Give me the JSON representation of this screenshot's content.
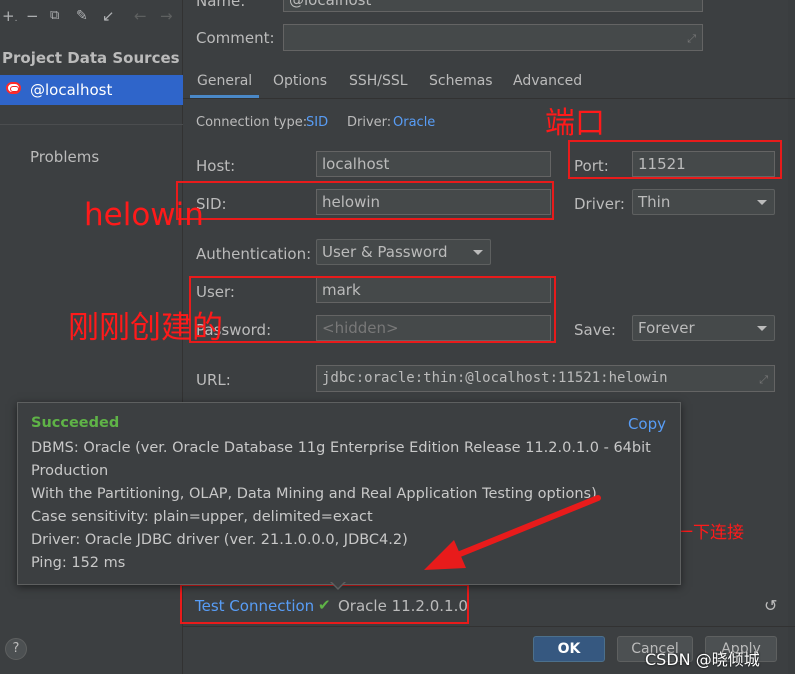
{
  "sidebar": {
    "toolbar_icons": [
      "+.",
      "−",
      "⧉",
      "🔧",
      "↙",
      "←",
      "→"
    ],
    "title": "Project Data Sources",
    "selected_item": "@localhost",
    "problems": "Problems",
    "help": "?"
  },
  "header": {
    "name_label": "Name:",
    "name_value": "@localhost",
    "comment_label": "Comment:"
  },
  "tabs": [
    {
      "label": "General"
    },
    {
      "label": "Options"
    },
    {
      "label": "SSH/SSL"
    },
    {
      "label": "Schemas"
    },
    {
      "label": "Advanced"
    }
  ],
  "connection": {
    "type_label": "Connection type:",
    "type_value": "SID",
    "driver_label": "Driver:",
    "driver_value": "Oracle"
  },
  "form": {
    "host_label": "Host:",
    "host_value": "localhost",
    "port_label": "Port:",
    "port_value": "11521",
    "sid_label": "SID:",
    "sid_value": "helowin",
    "driver_label": "Driver:",
    "driver_value": "Thin",
    "auth_label": "Authentication:",
    "auth_value": "User & Password",
    "user_label": "User:",
    "user_value": "mark",
    "password_label": "Password:",
    "password_placeholder": "<hidden>",
    "save_label": "Save:",
    "save_value": "Forever",
    "url_label": "URL:",
    "url_value": "jdbc:oracle:thin:@localhost:11521:helowin"
  },
  "annotations": {
    "port_note": "端口",
    "sid_note": "helowin",
    "user_note": "刚刚创建的",
    "test_note": "测试一下连接"
  },
  "popup": {
    "status": "Succeeded",
    "copy": "Copy",
    "lines": [
      "DBMS: Oracle (ver. Oracle Database 11g Enterprise Edition Release 11.2.0.1.0 - 64bit",
      "Production",
      "With the Partitioning, OLAP, Data Mining and Real Application Testing options)",
      "Case sensitivity: plain=upper, delimited=exact",
      "Driver: Oracle JDBC driver (ver. 21.1.0.0.0, JDBC4.2)",
      "Ping: 152 ms"
    ]
  },
  "footer": {
    "test_connection": "Test Connection",
    "test_result": "Oracle 11.2.0.1.0",
    "ok": "OK",
    "cancel": "Cancel",
    "apply": "Apply",
    "watermark": "CSDN @晓倾城"
  },
  "colors": {
    "accent": "#4a88c7",
    "link": "#589df6",
    "success": "#5fb347",
    "annotation_red": "#e81b1b",
    "selected": "#2f65ca"
  }
}
